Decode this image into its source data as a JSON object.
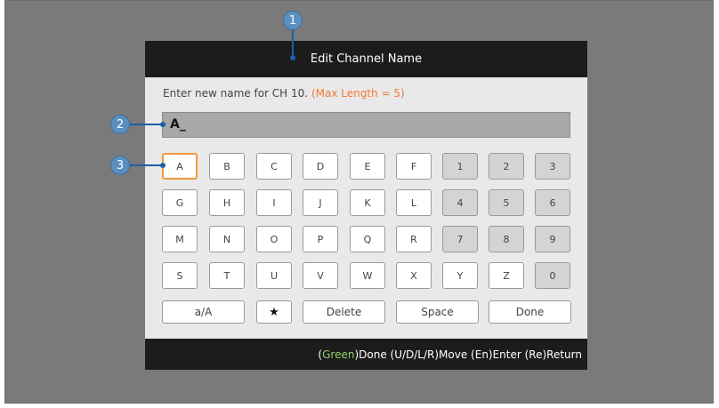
{
  "dialog": {
    "title": "Edit Channel Name",
    "prompt": "Enter new name for CH 10.",
    "max_length": "(Max Length = 5)",
    "name_value": "A_"
  },
  "keys": {
    "rows": [
      [
        "A",
        "B",
        "C",
        "D",
        "E",
        "F",
        "1",
        "2",
        "3"
      ],
      [
        "G",
        "H",
        "I",
        "J",
        "K",
        "L",
        "4",
        "5",
        "6"
      ],
      [
        "M",
        "N",
        "O",
        "P",
        "Q",
        "R",
        "7",
        "8",
        "9"
      ],
      [
        "S",
        "T",
        "U",
        "V",
        "W",
        "X",
        "Y",
        "Z",
        "0"
      ]
    ],
    "numeric_keys": [
      "1",
      "2",
      "3",
      "4",
      "5",
      "6",
      "7",
      "8",
      "9",
      "0"
    ],
    "selected_key": "A",
    "case_toggle": "a/A",
    "star": "★",
    "delete": "Delete",
    "space": "Space",
    "done": "Done"
  },
  "footer": {
    "green_label": "Green",
    "hints_1": ")Done  (U/D/L/R)Move  (En)Enter  (Re)Return",
    "paren_open": "("
  },
  "callouts": [
    "1",
    "2",
    "3"
  ],
  "colors": {
    "selected_border": "#f29a3a",
    "max_length_text": "#f07a3a",
    "green_hint": "#8fd16a",
    "callout_fill": "#5b8fbf",
    "callout_line": "#1f5fa6"
  }
}
